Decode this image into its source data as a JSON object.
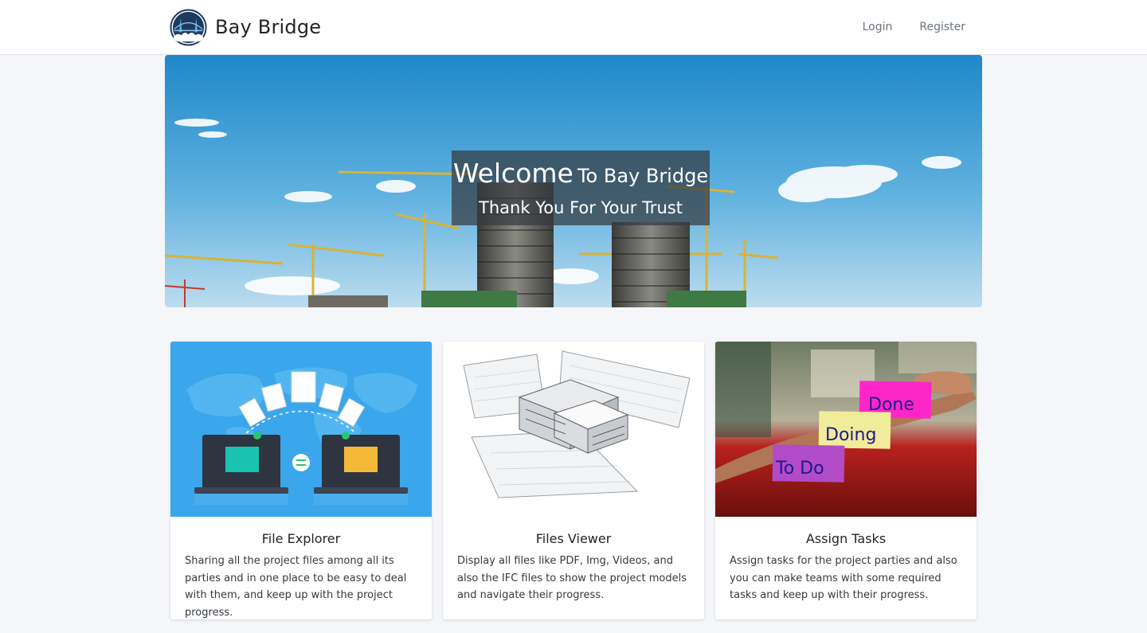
{
  "navbar": {
    "brand_name": "Bay Bridge",
    "logo_icon": "bay-bridge-logo-icon",
    "links": {
      "login": "Login",
      "register": "Register"
    }
  },
  "hero": {
    "title_welcome": "Welcome",
    "title_rest": "To Bay Bridge",
    "subtitle": "Thank You For Your Trust",
    "image": "construction-cranes-sky-image"
  },
  "cards": [
    {
      "title": "File Explorer",
      "text": "Sharing all the project files among all its parties and in one place to be easy to deal with them, and keep up with the project progress.",
      "image": "file-transfer-illustration"
    },
    {
      "title": "Files Viewer",
      "text": "Display all files like PDF, Img, Videos, and also the IFC files to show the project models and navigate their progress.",
      "image": "bim-model-illustration"
    },
    {
      "title": "Assign Tasks",
      "text": "Assign tasks for the project parties and also you can make teams with some required tasks and keep up with their progress.",
      "image": "sticky-notes-photo",
      "notes": {
        "done": "Done",
        "doing": "Doing",
        "todo": "To Do"
      }
    }
  ],
  "colors": {
    "nav_bg": "#ffffff",
    "page_bg": "#f4f6f9",
    "link": "#6c757d",
    "brand_navy": "#1f3a5f"
  }
}
